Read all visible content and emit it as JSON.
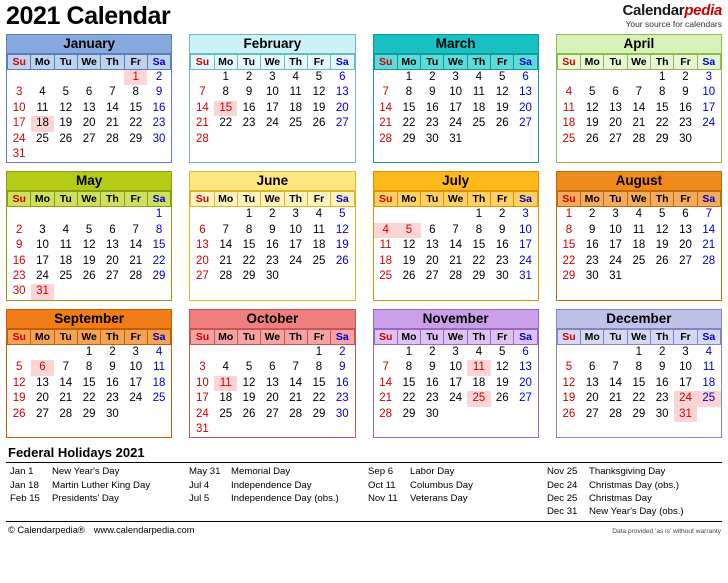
{
  "header": {
    "title": "2021 Calendar",
    "logo_black": "Calendar",
    "logo_red": "pedia",
    "logo_tagline": "Your source for calendars"
  },
  "weekday_headers": [
    "Su",
    "Mo",
    "Tu",
    "We",
    "Th",
    "Fr",
    "Sa"
  ],
  "colors": {
    "sunday_text": "#cc0000",
    "saturday_text": "#0000cc",
    "holiday_highlight": "#fbd5d5",
    "logo_accent": "#cc0000"
  },
  "months": [
    {
      "name": "January",
      "header_color": "#87aade",
      "weekday_color": "#bcd2ee",
      "border_color": "#5a7fb5",
      "first_weekday_index": 5,
      "days": 31,
      "holidays": [
        1,
        18
      ],
      "holiday_text_days": [
        1
      ]
    },
    {
      "name": "February",
      "header_color": "#ccf2f7",
      "weekday_color": "#e3f8fb",
      "border_color": "#6fb9c4",
      "first_weekday_index": 1,
      "days": 28,
      "holidays": [
        15
      ],
      "holiday_text_days": [
        15
      ]
    },
    {
      "name": "March",
      "header_color": "#17c1c1",
      "weekday_color": "#5ddbdb",
      "border_color": "#139a9a",
      "first_weekday_index": 1,
      "days": 31,
      "holidays": [],
      "holiday_text_days": []
    },
    {
      "name": "April",
      "header_color": "#d7f2b6",
      "weekday_color": "#e7f7d2",
      "border_color": "#8bbd4e",
      "first_weekday_index": 4,
      "days": 30,
      "holidays": [],
      "holiday_text_days": []
    },
    {
      "name": "May",
      "header_color": "#b3cc17",
      "weekday_color": "#cfe05e",
      "border_color": "#8a9e10",
      "first_weekday_index": 6,
      "days": 31,
      "holidays": [
        31
      ],
      "holiday_text_days": [
        31
      ]
    },
    {
      "name": "June",
      "header_color": "#ffe680",
      "weekday_color": "#fff2bf",
      "border_color": "#d6b829",
      "first_weekday_index": 2,
      "days": 30,
      "holidays": [],
      "holiday_text_days": []
    },
    {
      "name": "July",
      "header_color": "#ffb81c",
      "weekday_color": "#ffd066",
      "border_color": "#d99400",
      "first_weekday_index": 4,
      "days": 31,
      "holidays": [
        4,
        5
      ],
      "holiday_text_days": [
        4,
        5
      ]
    },
    {
      "name": "August",
      "header_color": "#f08a1c",
      "weekday_color": "#f5ab5c",
      "border_color": "#c26a08",
      "first_weekday_index": 0,
      "days": 31,
      "holidays": [],
      "holiday_text_days": []
    },
    {
      "name": "September",
      "header_color": "#f07d18",
      "weekday_color": "#f4a355",
      "border_color": "#c05f05",
      "first_weekday_index": 3,
      "days": 30,
      "holidays": [
        6
      ],
      "holiday_text_days": [
        6
      ]
    },
    {
      "name": "October",
      "header_color": "#ef7f7f",
      "weekday_color": "#f5a3a3",
      "border_color": "#c85555",
      "first_weekday_index": 5,
      "days": 31,
      "holidays": [
        11
      ],
      "holiday_text_days": [
        11
      ]
    },
    {
      "name": "November",
      "header_color": "#c9a0e8",
      "weekday_color": "#ddc2f2",
      "border_color": "#9a68c4",
      "first_weekday_index": 1,
      "days": 30,
      "holidays": [
        11,
        25
      ],
      "holiday_text_days": [
        11,
        25
      ]
    },
    {
      "name": "December",
      "header_color": "#bfc2e8",
      "weekday_color": "#d6d8f2",
      "border_color": "#8186c4",
      "first_weekday_index": 3,
      "days": 31,
      "holidays": [
        24,
        25,
        31
      ],
      "holiday_text_days": [
        24,
        25,
        31
      ]
    }
  ],
  "holidays_section": {
    "title": "Federal Holidays 2021",
    "columns": [
      [
        {
          "date": "Jan 1",
          "name": "New Year's Day"
        },
        {
          "date": "Jan 18",
          "name": "Martin Luther King Day"
        },
        {
          "date": "Feb 15",
          "name": "Presidents' Day"
        }
      ],
      [
        {
          "date": "May 31",
          "name": "Memorial Day"
        },
        {
          "date": "Jul 4",
          "name": "Independence Day"
        },
        {
          "date": "Jul 5",
          "name": "Independence Day (obs.)"
        }
      ],
      [
        {
          "date": "Sep 6",
          "name": "Labor Day"
        },
        {
          "date": "Oct 11",
          "name": "Columbus Day"
        },
        {
          "date": "Nov 11",
          "name": "Veterans Day"
        }
      ],
      [
        {
          "date": "Nov 25",
          "name": "Thanksgiving Day"
        },
        {
          "date": "Dec 24",
          "name": "Christmas Day (obs.)"
        },
        {
          "date": "Dec 25",
          "name": "Christmas Day"
        },
        {
          "date": "Dec 31",
          "name": "New Year's Day (obs.)"
        }
      ]
    ]
  },
  "footer": {
    "copyright": "© Calendarpedia®",
    "website": "www.calendarpedia.com",
    "disclaimer": "Data provided 'as is' without warranty"
  }
}
